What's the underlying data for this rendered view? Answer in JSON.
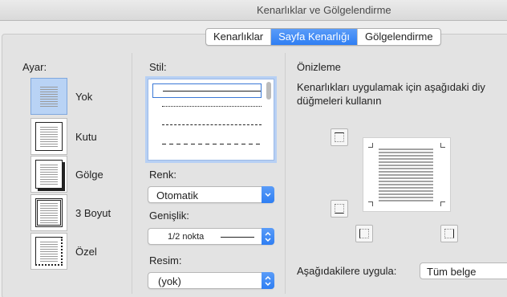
{
  "window": {
    "title": "Kenarlıklar ve Gölgelendirme"
  },
  "tabs": [
    {
      "label": "Kenarlıklar",
      "active": false
    },
    {
      "label": "Sayfa Kenarlığı",
      "active": true
    },
    {
      "label": "Gölgelendirme",
      "active": false
    }
  ],
  "settings": {
    "heading": "Ayar:",
    "items": [
      {
        "label": "Yok",
        "selected": true
      },
      {
        "label": "Kutu",
        "selected": false
      },
      {
        "label": "Gölge",
        "selected": false
      },
      {
        "label": "3 Boyut",
        "selected": false
      },
      {
        "label": "Özel",
        "selected": false
      }
    ]
  },
  "style": {
    "heading": "Stil:",
    "line_styles": [
      "solid",
      "dotted",
      "dashed",
      "long-dashed"
    ],
    "selected": "solid"
  },
  "color": {
    "label": "Renk:",
    "value": "Otomatik"
  },
  "width": {
    "label": "Genişlik:",
    "value": "1/2 nokta"
  },
  "art": {
    "label": "Resim:",
    "value": "(yok)"
  },
  "preview": {
    "heading": "Önizleme",
    "instruction_line1": "Kenarlıkları uygulamak için aşağıdaki diy",
    "instruction_line2": "düğmeleri kullanın"
  },
  "apply_to": {
    "label": "Aşağıdakilere uygula:",
    "value": "Tüm belge"
  },
  "colors": {
    "accent": "#2e7ef3",
    "selection": "#b9d3f5"
  }
}
